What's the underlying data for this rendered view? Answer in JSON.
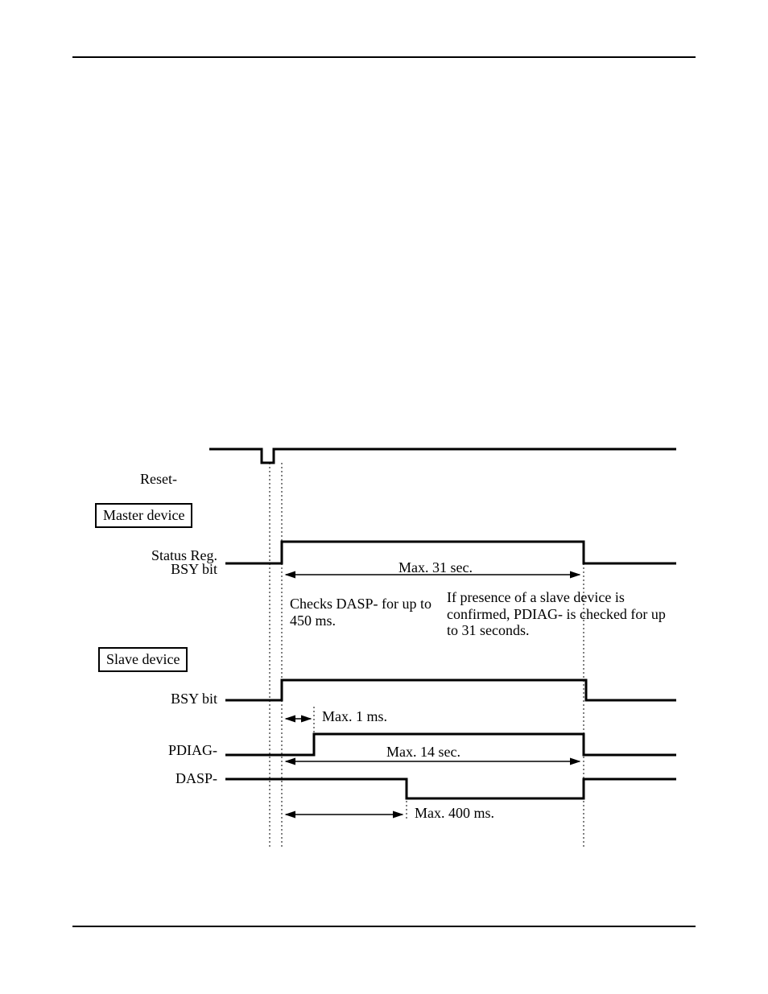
{
  "signals": {
    "reset": "Reset-",
    "master_box": "Master device",
    "status_reg": "Status Reg.",
    "bsy_bit": "BSY bit",
    "slave_box": "Slave device",
    "slave_bsy": "BSY bit",
    "pdiag": "PDIAG-",
    "dasp": "DASP-"
  },
  "annotations": {
    "max_31": "Max. 31 sec.",
    "checks_dasp": "Checks DASP- for up to 450 ms.",
    "slave_note": "If presence of a slave device is confirmed, PDIAG- is checked for up to 31 seconds.",
    "max_1ms": "Max. 1 ms.",
    "max_14s": "Max. 14 sec.",
    "max_400ms": "Max. 400 ms."
  },
  "chart_data": {
    "type": "timing_diagram",
    "title": "Hardware reset master/slave timing",
    "signals": [
      {
        "name": "Reset-",
        "role": "input",
        "shape": "negative_pulse"
      },
      {
        "name": "Master Status Reg. BSY bit",
        "high_duration": "≤ 31 s",
        "goes_high_at": "reset trailing edge"
      },
      {
        "name": "Slave BSY bit",
        "high_duration": "tracks PDIAG-",
        "goes_high_at": "reset trailing edge"
      },
      {
        "name": "PDIAG-",
        "asserted_within": "≤ 14 s",
        "deassert_precondition": "≤ 1 ms after reset"
      },
      {
        "name": "DASP-",
        "asserted_within": "≤ 400 ms"
      }
    ],
    "notes": [
      "Master checks DASP- for up to 450 ms after reset.",
      "If a slave is present, master then checks PDIAG- for up to 31 s."
    ]
  }
}
